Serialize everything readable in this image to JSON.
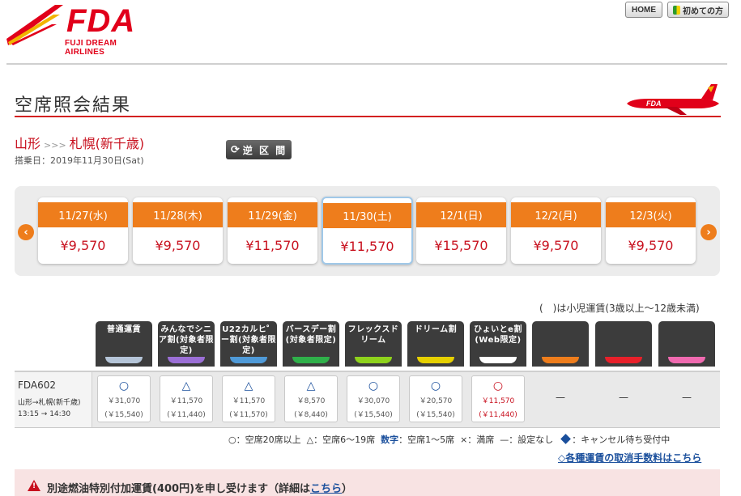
{
  "header": {
    "logo_text": "FDA",
    "logo_sub": "FUJI DREAM AIRLINES",
    "home_label": "HOME",
    "first_time_label": "初めての方"
  },
  "page": {
    "title": "空席照会結果",
    "origin": "山形",
    "route_sep": ">>>",
    "destination": "札幌(新千歳)",
    "board_date": "搭乗日：2019年11月30日(Sat)",
    "reverse_label": "逆 区 間"
  },
  "dates": [
    {
      "label": "11/27(水)",
      "price": "¥9,570"
    },
    {
      "label": "11/28(木)",
      "price": "¥9,570"
    },
    {
      "label": "11/29(金)",
      "price": "¥11,570"
    },
    {
      "label": "11/30(土)",
      "price": "¥11,570"
    },
    {
      "label": "12/1(日)",
      "price": "¥15,570"
    },
    {
      "label": "12/2(月)",
      "price": "¥9,570"
    },
    {
      "label": "12/3(火)",
      "price": "¥9,570"
    }
  ],
  "child_note": "(　)は小児運賃(3歳以上〜12歳未満)",
  "fare_types": [
    {
      "label": "普通運賃",
      "stripe": "#b5c5d8"
    },
    {
      "label": "みんなでシニア割(対象者限定)",
      "stripe": "#9b6fd6"
    },
    {
      "label": "U22カルヒ゜ー割(対象者限定)",
      "stripe": "#4f9ad8"
    },
    {
      "label": "バースデー割(対象者限定)",
      "stripe": "#2fb04a"
    },
    {
      "label": "フレックスドリーム",
      "stripe": "#8ed21c"
    },
    {
      "label": "ドリーム割",
      "stripe": "#e6d000"
    },
    {
      "label": "ひょいとe割(Web限定)",
      "stripe": "#ffffff"
    },
    {
      "label": "",
      "stripe": "#ee7d1c"
    },
    {
      "label": "",
      "stripe": "#e8202a"
    },
    {
      "label": "",
      "stripe": "#f06ab0"
    }
  ],
  "flight": {
    "number": "FDA602",
    "route": "山形→札幌(新千歳)",
    "time": "13:15 → 14:30",
    "fares": [
      {
        "mark": "○",
        "price": "￥31,070",
        "child": "(￥15,540)"
      },
      {
        "mark": "△",
        "price": "￥11,570",
        "child": "(￥11,440)"
      },
      {
        "mark": "△",
        "price": "￥11,570",
        "child": "(￥11,570)"
      },
      {
        "mark": "△",
        "price": "￥8,570",
        "child": "(￥8,440)"
      },
      {
        "mark": "○",
        "price": "￥30,070",
        "child": "(￥15,540)"
      },
      {
        "mark": "○",
        "price": "￥20,570",
        "child": "(￥15,540)"
      },
      {
        "mark": "○",
        "price": "￥11,570",
        "child": "(￥11,440)"
      }
    ],
    "empty": [
      "—",
      "—",
      "—"
    ]
  },
  "legend": {
    "circle": "○：空席20席以上",
    "triangle": "△：空席6〜19席",
    "num_label": "数字",
    "num_text": "：空席1〜5席",
    "cross": "×：満席",
    "dash": "—：設定なし",
    "diamond": "：キャンセル待ち受付中"
  },
  "cancel_link": "◇各種運賃の取消手数料はこちら",
  "warning": {
    "text": "別途燃油特別付加運賃(400円)を申し受けます（詳細は",
    "link": "こちら",
    "close": "）"
  }
}
